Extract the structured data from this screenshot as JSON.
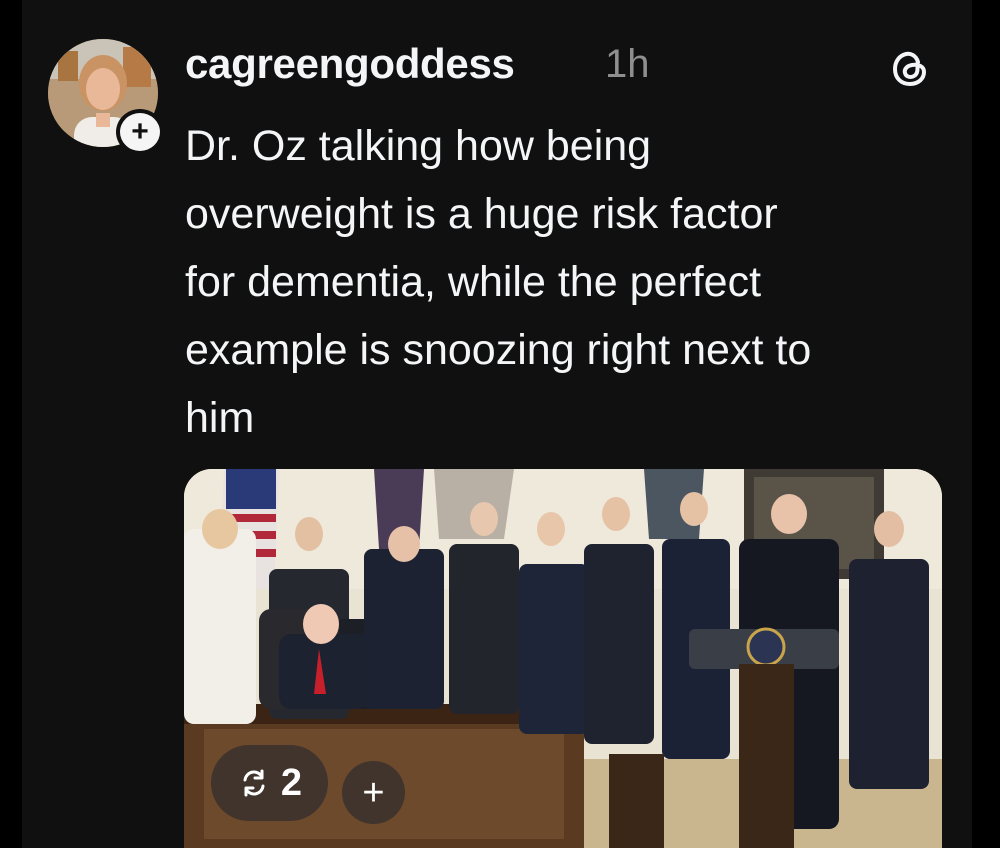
{
  "post": {
    "username": "cagreengoddess",
    "time": "1h",
    "text": "Dr. Oz talking how being\noverweight is a huge risk factor\nfor dementia, while the perfect\nexample is snoozing right next to\nhim",
    "follow_symbol": "+",
    "app_icon": "threads-icon"
  },
  "media": {
    "description_icon": "photo",
    "repost_count": "2",
    "repost_icon": "repost-icon",
    "add_symbol": "+"
  },
  "colors": {
    "background": "#101010",
    "text": "#f3f5f7",
    "muted": "#8f8f8f",
    "pill": "#3c322e"
  }
}
